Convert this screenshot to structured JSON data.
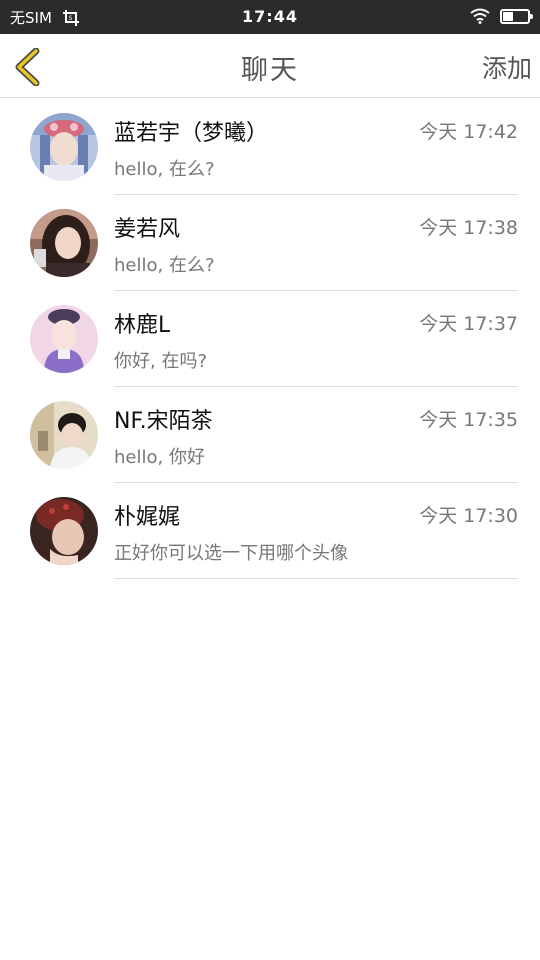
{
  "status_bar": {
    "carrier": "无SIM",
    "time": "17:44",
    "battery_level": 0.4
  },
  "nav": {
    "back_icon": "chevron-left-icon",
    "title": "聊天",
    "add_label": "添加",
    "accent_color": "#e6c820"
  },
  "chats": [
    {
      "name": "蓝若宇（梦曦）",
      "time": "今天 17:42",
      "preview": "hello, 在么?"
    },
    {
      "name": "姜若风",
      "time": "今天 17:38",
      "preview": "hello, 在么?"
    },
    {
      "name": "林鹿L",
      "time": "今天 17:37",
      "preview": "你好, 在吗?"
    },
    {
      "name": "NF.宋陌茶",
      "time": "今天 17:35",
      "preview": "hello, 你好"
    },
    {
      "name": "朴娓娓",
      "time": "今天 17:30",
      "preview": "正好你可以选一下用哪个头像"
    }
  ]
}
